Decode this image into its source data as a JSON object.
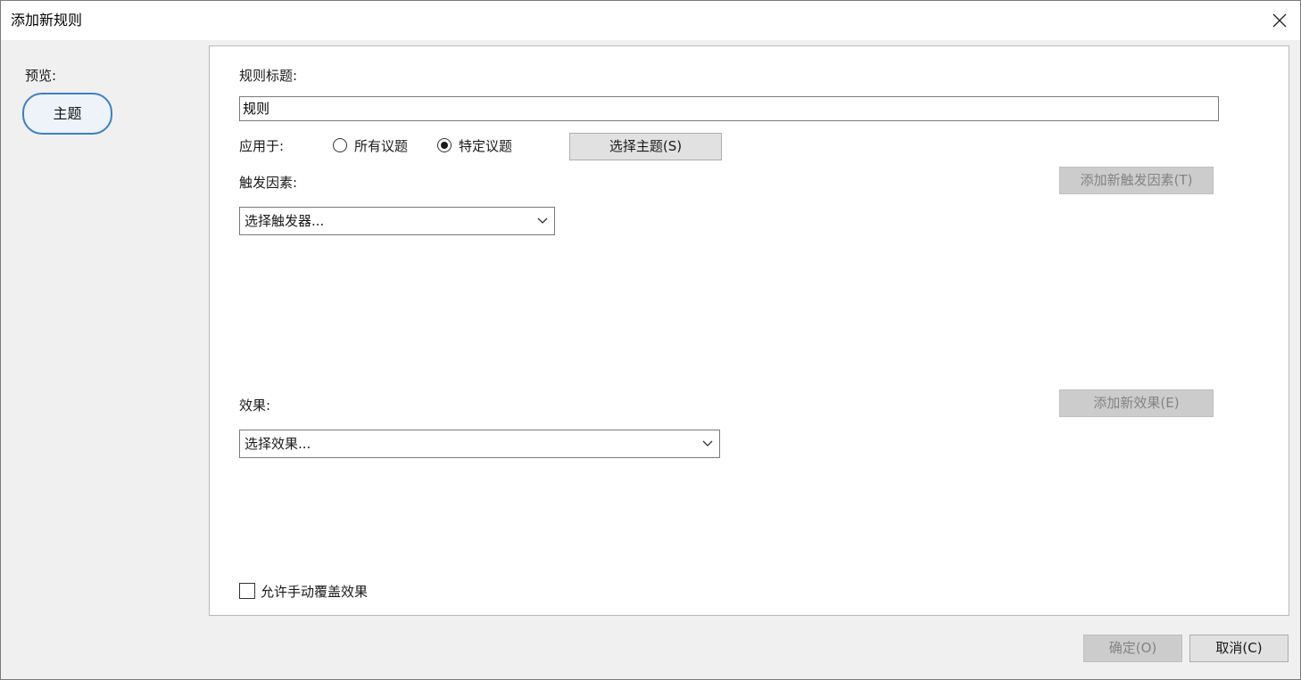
{
  "window": {
    "title": "添加新规则"
  },
  "preview": {
    "label": "预览:",
    "node_text": "主题"
  },
  "form": {
    "rule_title_label": "规则标题:",
    "rule_title_value": "规则",
    "apply_to_label": "应用于:",
    "apply_options": [
      {
        "label": "所有议题",
        "checked": false
      },
      {
        "label": "特定议题",
        "checked": true
      }
    ],
    "select_topic_button": "选择主题(S)",
    "trigger_label": "触发因素:",
    "add_trigger_button": "添加新触发因素(T)",
    "trigger_select": "选择触发器...",
    "effect_label": "效果:",
    "add_effect_button": "添加新效果(E)",
    "effect_select": "选择效果...",
    "allow_override_label": "允许手动覆盖效果",
    "allow_override_checked": false
  },
  "footer": {
    "ok_button": "确定(O)",
    "cancel_button": "取消(C)"
  },
  "colors": {
    "accent": "#3d7fc0",
    "panel_bg": "#ffffff",
    "window_bg": "#f0f0f0",
    "disabled_button": "#cccccc"
  },
  "icons": {
    "close": "close-icon",
    "dropdown": "chevron-down-icon"
  }
}
